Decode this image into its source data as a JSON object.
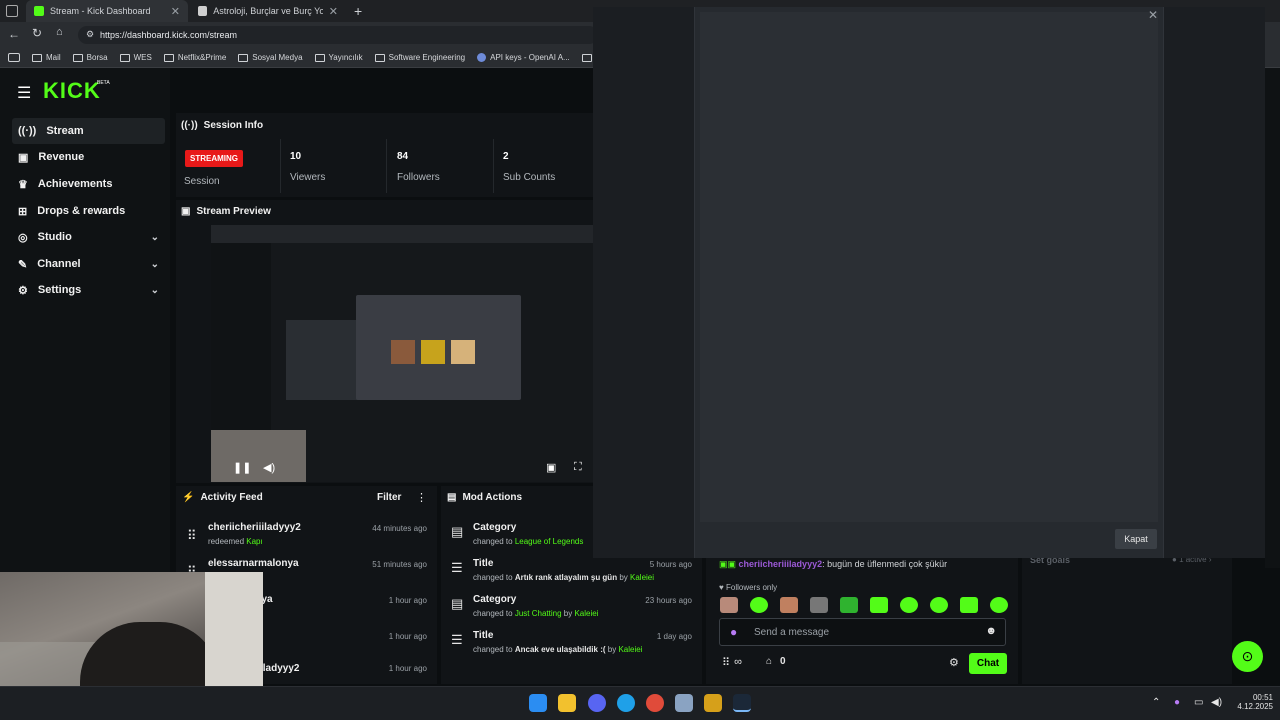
{
  "browser": {
    "tabs": [
      {
        "title": "Stream - Kick Dashboard",
        "active": true
      },
      {
        "title": "Astroloji, Burçlar ve Burç Yorumları",
        "active": false
      }
    ],
    "url": "https://dashboard.kick.com/stream",
    "bookmarks": [
      "Mail",
      "Borsa",
      "WES",
      "Netflix&Prime",
      "Sosyal Medya",
      "Yayıncılık",
      "Software Engineering",
      "API keys - OpenAI A...",
      "K"
    ]
  },
  "kick": {
    "logo": "KICK",
    "logo_tag": "BETA",
    "accent": "#53fc18",
    "nav": [
      {
        "label": "Stream",
        "active": true,
        "icon": "stream-icon",
        "expandable": false
      },
      {
        "label": "Revenue",
        "active": false,
        "icon": "revenue-icon",
        "expandable": false
      },
      {
        "label": "Achievements",
        "active": false,
        "icon": "trophy-icon",
        "expandable": false
      },
      {
        "label": "Drops & rewards",
        "active": false,
        "icon": "drops-icon",
        "expandable": false
      },
      {
        "label": "Studio",
        "active": false,
        "icon": "studio-icon",
        "expandable": true
      },
      {
        "label": "Channel",
        "active": false,
        "icon": "channel-icon",
        "expandable": true
      },
      {
        "label": "Settings",
        "active": false,
        "icon": "gear-icon",
        "expandable": true
      }
    ],
    "session_info": {
      "title": "Session Info",
      "status": "STREAMING",
      "session_label": "Session",
      "stats": [
        {
          "value": "10",
          "label": "Viewers"
        },
        {
          "value": "84",
          "label": "Followers"
        },
        {
          "value": "2",
          "label": "Sub Counts"
        }
      ]
    },
    "preview": {
      "title": "Stream Preview"
    },
    "activity_feed": {
      "title": "Activity Feed",
      "filter": "Filter",
      "items": [
        {
          "name": "cheriicheriiiladyyy2",
          "action": "redeemed",
          "target": "Kapı",
          "time": "44 minutes ago"
        },
        {
          "name": "elessarnarmalonya",
          "action": "",
          "target": "",
          "time": "51 minutes ago"
        },
        {
          "name": "malonya",
          "action": "",
          "target": "",
          "time": "1 hour ago"
        },
        {
          "name": "",
          "action": "",
          "target": "",
          "time": "1 hour ago"
        },
        {
          "name": "iladyyy2",
          "action": "",
          "target": "",
          "time": "1 hour ago"
        }
      ]
    },
    "mod_actions": {
      "title": "Mod Actions",
      "items": [
        {
          "title": "Category",
          "prefix": "changed to",
          "value": "League of Legends",
          "by": "",
          "time": ""
        },
        {
          "title": "Title",
          "prefix": "changed to",
          "value": "Artık rank atlayalım şu gün",
          "by": "Kaleiei",
          "time": "5 hours ago"
        },
        {
          "title": "Category",
          "prefix": "changed to",
          "value": "Just Chatting",
          "by": "Kaleiei",
          "time": "23 hours ago"
        },
        {
          "title": "Title",
          "prefix": "changed to",
          "value": "Ancak eve ulaşabildik :(",
          "by": "Kaleiei",
          "time": "1 day ago"
        }
      ],
      "by_word": "by"
    },
    "chat": {
      "last_message_user": "cheriicheriiiladyyy2",
      "last_message_text": ": bugün de üflenmedi çok şükür",
      "followers_only": "Followers only",
      "input_placeholder": "Send a message",
      "viewer_count": "∞",
      "points": "0",
      "send_label": "Chat"
    },
    "goals": {
      "label": "Set goals",
      "status": "1 active"
    }
  },
  "modal": {
    "close_label": "Kapat"
  },
  "taskbar": {
    "time": "00:51",
    "date": "4.12.2025"
  }
}
